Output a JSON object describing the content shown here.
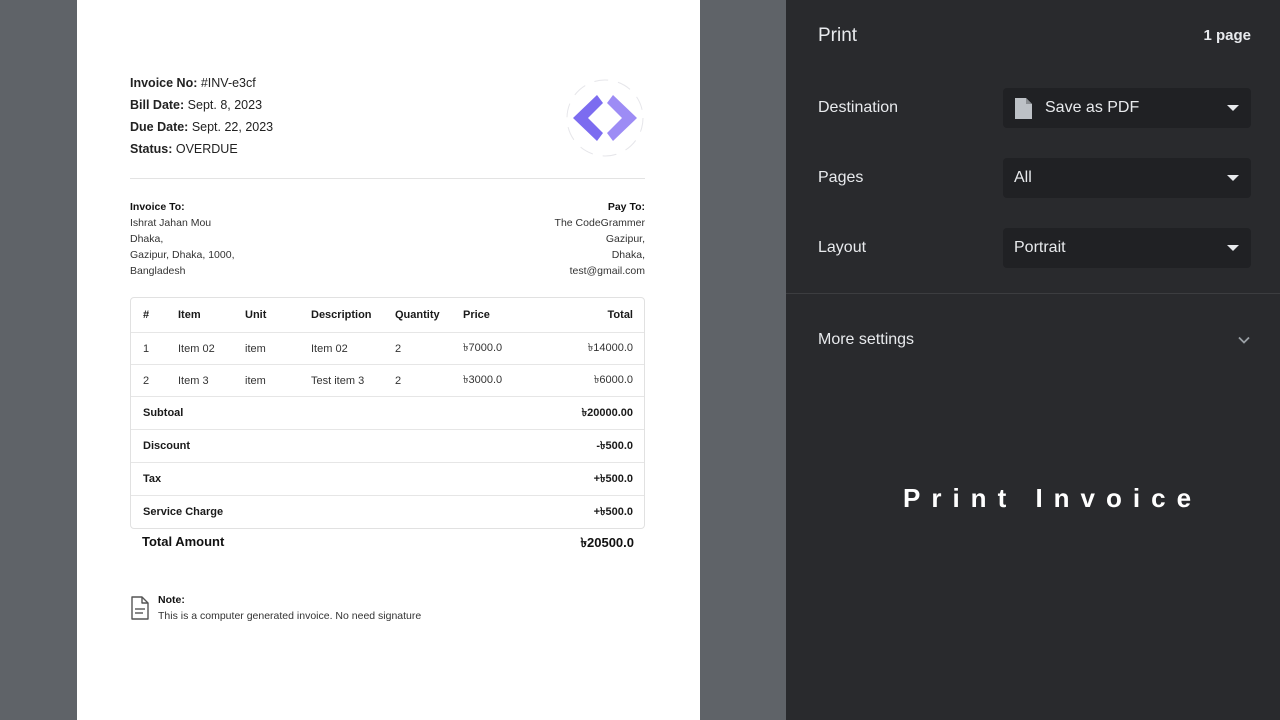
{
  "invoice": {
    "invoice_no_label": "Invoice No:",
    "invoice_no": " #INV-e3cf",
    "bill_date_label": "Bill Date:",
    "bill_date": " Sept. 8, 2023",
    "due_date_label": "Due Date:",
    "due_date": " Sept. 22, 2023",
    "status_label": "Status:",
    "status": " OVERDUE",
    "invoice_to": {
      "heading": "Invoice To:",
      "lines": [
        "Ishrat Jahan Mou",
        "Dhaka,",
        "Gazipur, Dhaka, 1000,",
        "Bangladesh"
      ]
    },
    "pay_to": {
      "heading": "Pay To:",
      "lines": [
        "The CodeGrammer",
        "Gazipur,",
        "Dhaka,",
        "test@gmail.com"
      ]
    },
    "table": {
      "headers": [
        "#",
        "Item",
        "Unit",
        "Description",
        "Quantity",
        "Price",
        "Total"
      ],
      "rows": [
        [
          "1",
          "Item 02",
          "item",
          "Item 02",
          "2",
          "৳7000.0",
          "৳14000.0"
        ],
        [
          "2",
          "Item 3",
          "item",
          "Test item 3",
          "2",
          "৳3000.0",
          "৳6000.0"
        ]
      ],
      "summary": [
        {
          "label": "Subtoal",
          "value": "৳20000.00"
        },
        {
          "label": "Discount",
          "value": "-৳500.0"
        },
        {
          "label": "Tax",
          "value": "+৳500.0"
        },
        {
          "label": "Service Charge",
          "value": "+৳500.0"
        }
      ]
    },
    "total_amount_label": "Total Amount",
    "total_amount": "৳20500.0",
    "note_heading": "Note:",
    "note_text": "This is a computer generated invoice. No need signature",
    "logo_color": "#7c6cf0"
  },
  "print_panel": {
    "title": "Print",
    "page_count": "1 page",
    "destination_label": "Destination",
    "destination_value": "Save as PDF",
    "destination_icon": "document-icon",
    "pages_label": "Pages",
    "pages_value": "All",
    "layout_label": "Layout",
    "layout_value": "Portrait",
    "more_settings": "More settings"
  },
  "overlay_title": "Print Invoice"
}
